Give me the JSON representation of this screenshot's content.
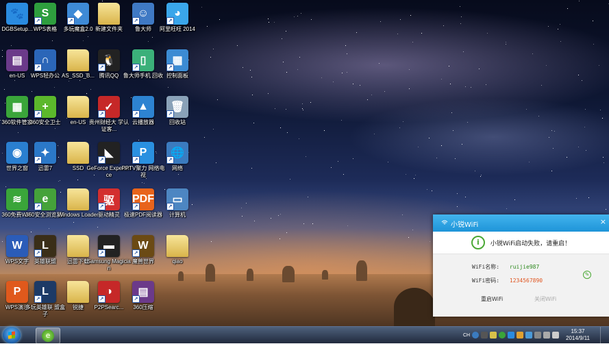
{
  "desktop": {
    "icons": [
      {
        "label": "DGBSetup...",
        "color": "#2a8be0",
        "glyph": "🐾"
      },
      {
        "label": "WPS表格",
        "color": "#2e9e3e",
        "glyph": "S"
      },
      {
        "label": "多玩魔盒2.0",
        "color": "#3e8ad6",
        "glyph": "◆"
      },
      {
        "label": "新建文件夹",
        "color": "#e8c45a",
        "glyph": "",
        "folder": true
      },
      {
        "label": "鲁大师",
        "color": "#3f79c4",
        "glyph": "☺"
      },
      {
        "label": "阿里旺旺 2014",
        "color": "#3aa6ea",
        "glyph": "◕"
      },
      {
        "label": "en-US",
        "color": "#6b3a8a",
        "glyph": "▤"
      },
      {
        "label": "WPS轻办公",
        "color": "#2b66b8",
        "glyph": "∩"
      },
      {
        "label": "AS_SSD_B...",
        "color": "#e8c45a",
        "glyph": "",
        "folder": true
      },
      {
        "label": "腾讯QQ",
        "color": "#222",
        "glyph": "🐧"
      },
      {
        "label": "鲁大师手机 回收",
        "color": "#3bb07a",
        "glyph": "▯"
      },
      {
        "label": "控制面板",
        "color": "#3c8bd3",
        "glyph": "▦"
      },
      {
        "label": "360软件管家",
        "color": "#3aa53a",
        "glyph": "▦"
      },
      {
        "label": "360安全卫士",
        "color": "#5cb82c",
        "glyph": "+"
      },
      {
        "label": "en-US",
        "color": "#e8c45a",
        "glyph": "",
        "folder": true
      },
      {
        "label": "贵州财经大 学认证客...",
        "color": "#c62828",
        "glyph": "✓"
      },
      {
        "label": "云播放器",
        "color": "#2d83d1",
        "glyph": "▲"
      },
      {
        "label": "回收站",
        "color": "#8aa2b8",
        "glyph": "🗑"
      },
      {
        "label": "世界之窗",
        "color": "#2a7fd0",
        "glyph": "◉"
      },
      {
        "label": "迅雷7",
        "color": "#2b78c8",
        "glyph": "✦"
      },
      {
        "label": "SSD",
        "color": "#e8c45a",
        "glyph": "",
        "folder": true
      },
      {
        "label": "GeForce Experience",
        "color": "#222",
        "glyph": "◣"
      },
      {
        "label": "PPTV聚力 网络电视",
        "color": "#2a90e0",
        "glyph": "P"
      },
      {
        "label": "网络",
        "color": "#3b7bbf",
        "glyph": "🌐"
      },
      {
        "label": "360免费WiFi",
        "color": "#3aa53a",
        "glyph": "≋"
      },
      {
        "label": "360安全浏览器6",
        "color": "#45a23a",
        "glyph": "e"
      },
      {
        "label": "Windows Loader",
        "color": "#e8c45a",
        "glyph": "",
        "folder": true
      },
      {
        "label": "驱动精灵",
        "color": "#d32f2f",
        "glyph": "驱"
      },
      {
        "label": "极速PDF阅读器",
        "color": "#e8641c",
        "glyph": "PDF"
      },
      {
        "label": "计算机",
        "color": "#4d86c2",
        "glyph": "▭"
      },
      {
        "label": "WPS文字",
        "color": "#2b5cb8",
        "glyph": "W"
      },
      {
        "label": "英雄联盟",
        "color": "#3a2e18",
        "glyph": "L"
      },
      {
        "label": "迅雷下载",
        "color": "#e8c45a",
        "glyph": "",
        "folder": true
      },
      {
        "label": "Samsung Magician",
        "color": "#222",
        "glyph": "▬"
      },
      {
        "label": "魔兽世界",
        "color": "#6b4a14",
        "glyph": "W"
      },
      {
        "label": "qiao",
        "color": "#e8c45a",
        "glyph": "",
        "folder": true
      },
      {
        "label": "WPS演示",
        "color": "#e0591c",
        "glyph": "P"
      },
      {
        "label": "多玩英雄联 盟盒子",
        "color": "#1d3a66",
        "glyph": "L"
      },
      {
        "label": "锐捷",
        "color": "#e8c45a",
        "glyph": "",
        "folder": true
      },
      {
        "label": "P2PSearc...",
        "color": "#c62828",
        "glyph": "◑"
      },
      {
        "label": "360压缩",
        "color": "#6b3a8a",
        "glyph": "▤"
      }
    ]
  },
  "popup": {
    "title": "小锐WiFi",
    "close": "×",
    "message": "小锐WiFi启动失败，请重启！",
    "wifi_name_label": "WiFi名称:",
    "wifi_name": "ruijie987",
    "wifi_pwd_label": "WiFi密码:",
    "wifi_pwd": "1234567890",
    "restart_btn": "重启WiFi",
    "close_btn": "关闭WiFi",
    "colors": {
      "header": "#2ea3e3",
      "name": "#2f8a20",
      "password": "#e0551f"
    }
  },
  "taskbar": {
    "lang": "CH",
    "time": "15:37",
    "date": "2014/9/11"
  }
}
